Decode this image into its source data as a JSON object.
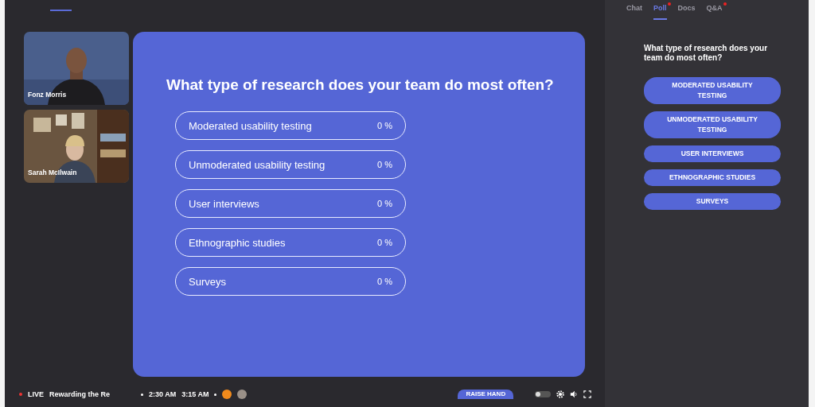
{
  "participants": [
    {
      "name": "Fonz Morris",
      "kind": "picture"
    },
    {
      "name": "Sarah McIlwain",
      "kind": "picture"
    }
  ],
  "poll": {
    "question": "What type of research does your team do most often?",
    "options": [
      {
        "label": "Moderated usability testing",
        "percent": "0 %"
      },
      {
        "label": "Unmoderated usability testing",
        "percent": "0 %"
      },
      {
        "label": "User interviews",
        "percent": "0 %"
      },
      {
        "label": "Ethnographic studies",
        "percent": "0 %"
      },
      {
        "label": "Surveys",
        "percent": "0 %"
      }
    ]
  },
  "sidebar": {
    "tabs": [
      {
        "label": "Chat",
        "selected": false,
        "notify": false
      },
      {
        "label": "Poll",
        "selected": true,
        "notify": true
      },
      {
        "label": "Docs",
        "selected": false,
        "notify": false
      },
      {
        "label": "Q&A",
        "selected": false,
        "notify": true
      }
    ],
    "question": "What type of research does your team do most often?",
    "answers": [
      "MODERATED USABILITY TESTING",
      "UNMODERATED USABILITY TESTING",
      "USER INTERVIEWS",
      "ETHNOGRAPHIC STUDIES",
      "SURVEYS"
    ]
  },
  "bottom_bar": {
    "live": "LIVE",
    "session": "Rewarding the Re",
    "start": "2:30 AM",
    "end": "3:15 AM",
    "raise_hand": "RAISE HAND",
    "toggle_on": false
  }
}
